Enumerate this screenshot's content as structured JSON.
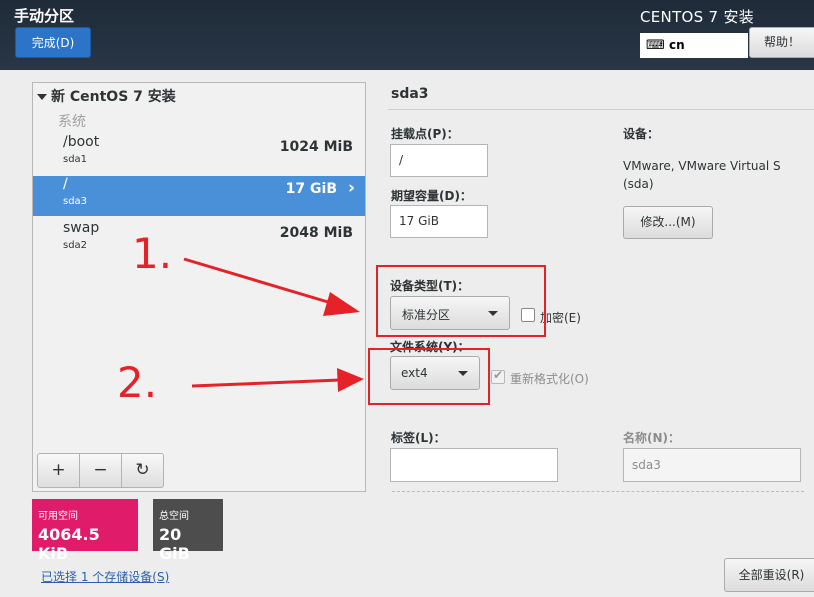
{
  "header": {
    "page_title": "手动分区",
    "done_button": "完成(D)",
    "product_title": "CENTOS 7 安装",
    "keyboard_layout": "cn",
    "help_button": "帮助！"
  },
  "partitions": {
    "install_title": "新 CentOS 7 安装",
    "section_label": "系统",
    "items": [
      {
        "name": "/boot",
        "device": "sda1",
        "size": "1024 MiB",
        "selected": false
      },
      {
        "name": "/",
        "device": "sda3",
        "size": "17 GiB",
        "selected": true
      },
      {
        "name": "swap",
        "device": "sda2",
        "size": "2048 MiB",
        "selected": false
      }
    ],
    "toolbar": {
      "add": "+",
      "remove": "−",
      "refresh": "↻"
    }
  },
  "space": {
    "available_label": "可用空间",
    "available_value": "4064.5 KiB",
    "available_color": "#e01c6a",
    "total_label": "总空间",
    "total_value": "20 GiB",
    "total_color": "#4d4d4d"
  },
  "storage_link": "已选择 1 个存储设备(S)",
  "reset_button": "全部重设(R)",
  "details": {
    "title": "sda3",
    "mount_point_label": "挂载点(P)：",
    "mount_point_value": "/",
    "capacity_label": "期望容量(D)：",
    "capacity_value": "17 GiB",
    "device_label": "设备：",
    "device_value": "VMware, VMware Virtual S (sda)",
    "modify_button": "修改...(M)",
    "device_type_label": "设备类型(T)：",
    "device_type_value": "标准分区",
    "encrypt_label": "加密(E)",
    "encrypt_checked": false,
    "filesystem_label": "文件系统(Y)：",
    "filesystem_value": "ext4",
    "reformat_label": "重新格式化(O)",
    "reformat_checked": true,
    "tag_label": "标签(L)：",
    "tag_value": "",
    "name_label": "名称(N)：",
    "name_value": "sda3"
  },
  "annotations": {
    "step1": "1.",
    "step2": "2.",
    "color": "#e52228"
  }
}
